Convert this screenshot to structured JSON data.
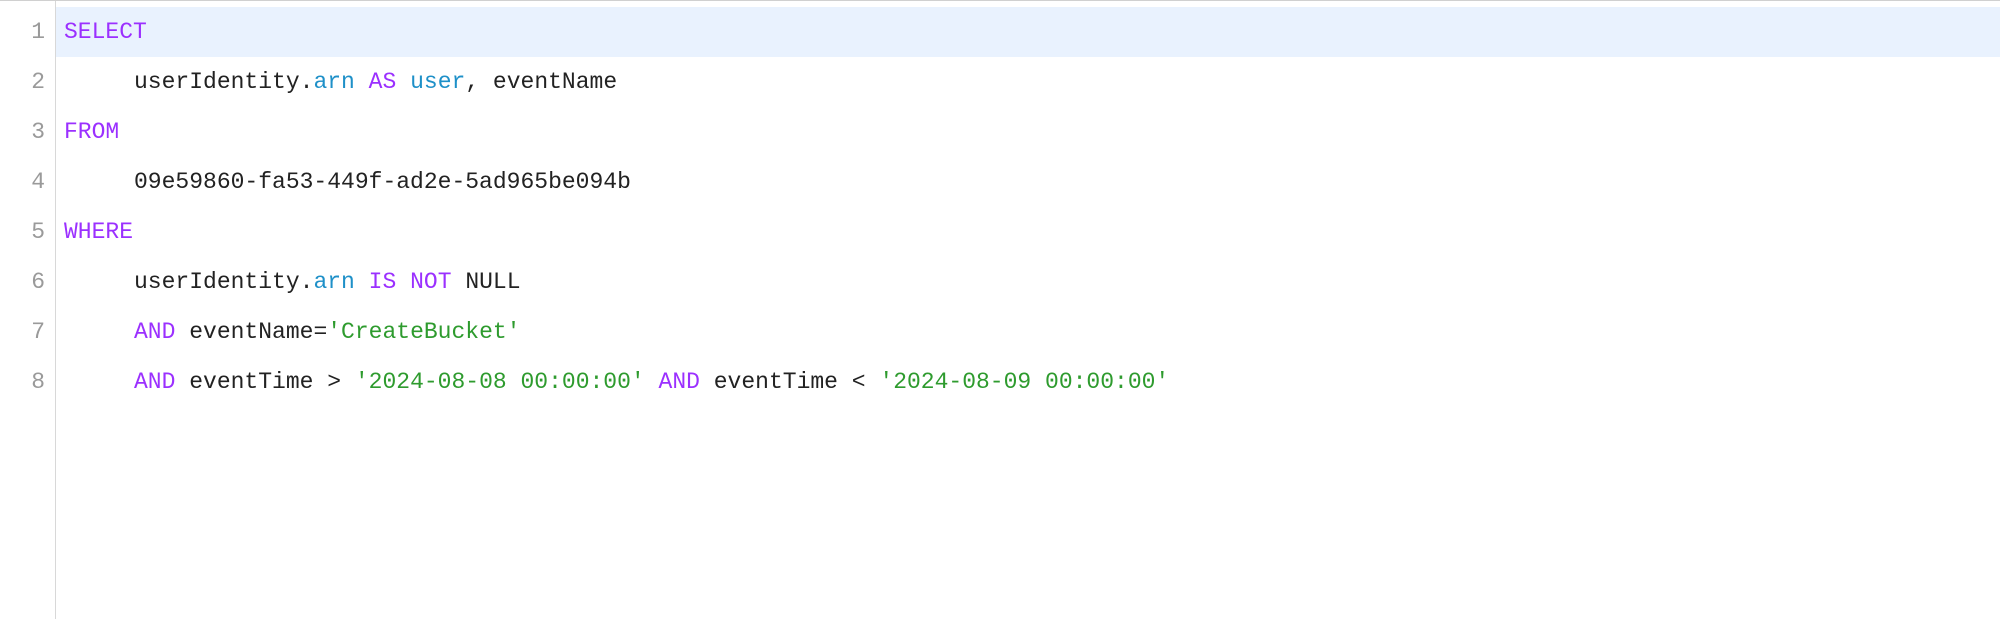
{
  "editor": {
    "gutter": [
      "1",
      "2",
      "3",
      "4",
      "5",
      "6",
      "7",
      "8"
    ],
    "highlighted_line_index": 0,
    "lines": {
      "l1": {
        "kw_select": "SELECT"
      },
      "l2": {
        "t1": "userIdentity",
        "dot": ".",
        "t2": "arn",
        "sp_as": " AS ",
        "t3": "user",
        "rest": ", eventName"
      },
      "l3": {
        "kw_from": "FROM"
      },
      "l4": {
        "t1": "09e59860-fa53-449f-ad2e-5ad965be094b"
      },
      "l5": {
        "kw_where": "WHERE"
      },
      "l6": {
        "t1": "userIdentity",
        "dot": ".",
        "t2": "arn",
        "sp_is": " IS ",
        "kw_not": "NOT",
        "sp_null": " NULL"
      },
      "l7": {
        "kw_and": "AND",
        "t1": " eventName=",
        "str1": "'CreateBucket'"
      },
      "l8": {
        "kw_and1": "AND",
        "t1": " eventTime > ",
        "str1": "'2024-08-08 00:00:00'",
        "sp": " ",
        "kw_and2": "AND",
        "t2": " eventTime < ",
        "str2": "'2024-08-09 00:00:00'"
      }
    }
  }
}
